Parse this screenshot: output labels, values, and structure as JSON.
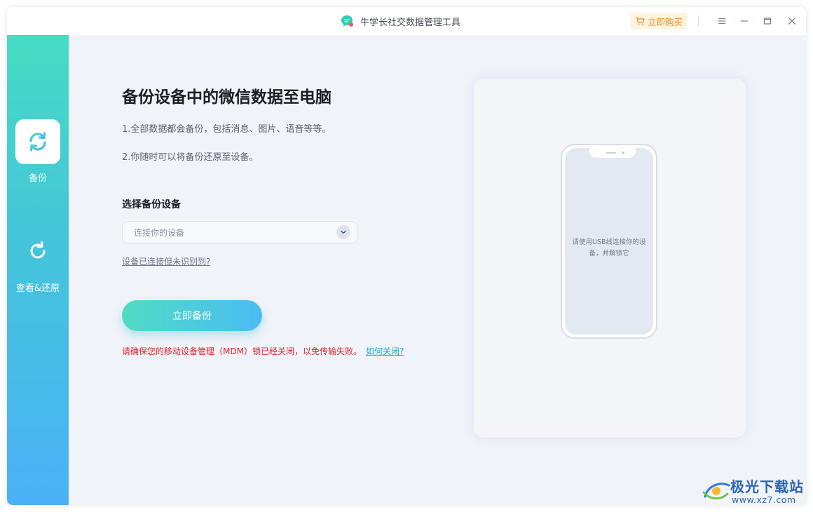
{
  "app": {
    "title": "牛学长社交数据管理工具",
    "buy_label": "立即购买"
  },
  "icons": {
    "app_logo": "chat-bubble-icon",
    "buy": "cart-icon",
    "menu": "menu-icon",
    "minimize": "minimize-icon",
    "maximize": "maximize-icon",
    "close": "close-icon",
    "backup": "sync-icon",
    "restore": "refresh-icon",
    "dropdown": "chevron-down-icon"
  },
  "sidebar": {
    "items": [
      {
        "label": "备份",
        "active": true
      },
      {
        "label": "查看&还原",
        "active": false
      }
    ]
  },
  "main": {
    "title": "备份设备中的微信数据至电脑",
    "desc1": "1.全部数据都会备份，包括消息、图片、语音等等。",
    "desc2": "2.你随时可以将备份还原至设备。",
    "select_label": "选择备份设备",
    "select_placeholder": "连接你的设备",
    "help_link": "设备已连接但未识别到?",
    "backup_button": "立即备份",
    "warning": "请确保您的移动设备管理（MDM）锁已经关闭，以免传输失败。",
    "howto_link": "如何关闭?"
  },
  "preview": {
    "hint": "请使用USB线连接你的设备，并解锁它"
  },
  "watermark": {
    "name": "极光下载站",
    "url": "www.xz7.com"
  },
  "colors": {
    "accent_start": "#46dcc3",
    "accent_end": "#4bb2f7",
    "warning": "#d9242a",
    "link": "#1fa6c9",
    "buy_text": "#e68a2e"
  }
}
